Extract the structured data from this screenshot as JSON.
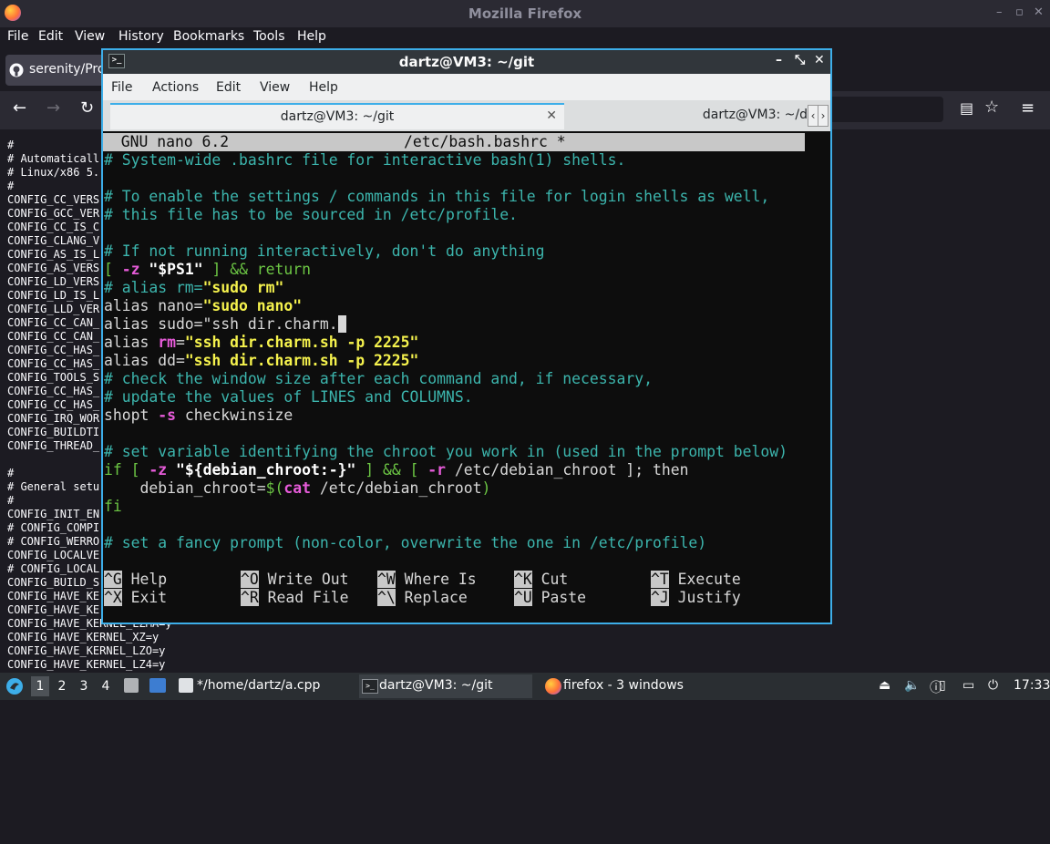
{
  "firefox": {
    "title": "Mozilla Firefox",
    "window_controls": [
      "–",
      "▫",
      "✕"
    ],
    "menu": [
      "File",
      "Edit",
      "View",
      "History",
      "Bookmarks",
      "Tools",
      "Help"
    ],
    "tab_label": "serenity/Pro",
    "content_lines": [
      "#",
      "# Automaticall",
      "# Linux/x86 5.",
      "#",
      "CONFIG_CC_VERS",
      "CONFIG_GCC_VER",
      "CONFIG_CC_IS_C",
      "CONFIG_CLANG_V",
      "CONFIG_AS_IS_L",
      "CONFIG_AS_VERS",
      "CONFIG_LD_VERS",
      "CONFIG_LD_IS_L",
      "CONFIG_LLD_VER",
      "CONFIG_CC_CAN_",
      "CONFIG_CC_CAN_",
      "CONFIG_CC_HAS_",
      "CONFIG_CC_HAS_",
      "CONFIG_TOOLS_S",
      "CONFIG_CC_HAS_",
      "CONFIG_CC_HAS_",
      "CONFIG_IRQ_WOR",
      "CONFIG_BUILDTI",
      "CONFIG_THREAD_",
      "",
      "#",
      "# General setu",
      "#",
      "CONFIG_INIT_EN",
      "# CONFIG_COMPI",
      "# CONFIG_WERRO",
      "CONFIG_LOCALVE",
      "# CONFIG_LOCAL",
      "CONFIG_BUILD_S",
      "CONFIG_HAVE_KE",
      "CONFIG_HAVE_KE",
      "CONFIG_HAVE_KERNEL_LZMA=y",
      "CONFIG_HAVE_KERNEL_XZ=y",
      "CONFIG_HAVE_KERNEL_LZO=y",
      "CONFIG_HAVE_KERNEL_LZ4=y"
    ]
  },
  "terminal": {
    "title": "dartz@VM3: ~/git",
    "menu": [
      "File",
      "Actions",
      "Edit",
      "View",
      "Help"
    ],
    "tabs": [
      {
        "label": "dartz@VM3: ~/git",
        "active": true
      },
      {
        "label": "dartz@VM3: ~/d",
        "active": false
      }
    ],
    "tab_close": "✕",
    "scroll_left": "‹",
    "scroll_right": "›"
  },
  "nano": {
    "header_left": "  GNU nano 6.2",
    "header_file": "/etc/bash.bashrc *",
    "lines": [
      {
        "t": "# System-wide .bashrc file for interactive bash(1) shells.",
        "c": "cm"
      },
      {
        "t": "",
        "c": "cm"
      },
      {
        "t": "# To enable the settings / commands in this file for login shells as well,",
        "c": "cm"
      },
      {
        "t": "# this file has to be sourced in /etc/profile.",
        "c": "cm"
      },
      {
        "t": "",
        "c": "cm"
      },
      {
        "t": "# If not running interactively, don't do anything",
        "c": "cm"
      }
    ],
    "l7": {
      "a": "[ ",
      "b": "-z",
      "c": " ",
      "d": "\"$PS1\"",
      "e": " ] && return"
    },
    "l8": {
      "a": "# alias rm=",
      "b": "\"sudo rm\""
    },
    "l9": {
      "a": "alias nano=",
      "b": "\"sudo nano\""
    },
    "l10": {
      "a": "alias sudo=\"ssh dir.charm.",
      "cursor": " "
    },
    "l11": {
      "a": "alias ",
      "b": "rm",
      "c": "=",
      "d": "\"ssh dir.charm.sh -p 2225\""
    },
    "l12": {
      "a": "alias dd=",
      "b": "\"ssh dir.charm.sh -p 2225\""
    },
    "l13": "# check the window size after each command and, if necessary,",
    "l14": "# update the values of LINES and COLUMNS.",
    "l15": {
      "a": "shopt ",
      "b": "-s",
      "c": " checkwinsize"
    },
    "l16": "",
    "l17": "# set variable identifying the chroot you work in (used in the prompt below)",
    "l18": {
      "a": "if [ ",
      "b": "-z",
      "c": " ",
      "d": "\"${debian_chroot:-}\"",
      "e": " ] && [ ",
      "f": "-r",
      "g": " /etc/debian_chroot ]; then"
    },
    "l19": {
      "a": "    debian_chroot=",
      "b": "$(",
      "c": "cat",
      "d": " /etc/debian_chroot",
      "e": ")"
    },
    "l20": "fi",
    "l21": "",
    "l22": "# set a fancy prompt (non-color, overwrite the one in /etc/profile)",
    "shortcuts": [
      [
        {
          "k": "^G",
          "l": "Help"
        },
        {
          "k": "^O",
          "l": "Write Out"
        },
        {
          "k": "^W",
          "l": "Where Is"
        },
        {
          "k": "^K",
          "l": "Cut"
        },
        {
          "k": "^T",
          "l": "Execute"
        }
      ],
      [
        {
          "k": "^X",
          "l": "Exit"
        },
        {
          "k": "^R",
          "l": "Read File"
        },
        {
          "k": "^\\",
          "l": "Replace"
        },
        {
          "k": "^U",
          "l": "Paste"
        },
        {
          "k": "^J",
          "l": "Justify"
        }
      ]
    ]
  },
  "taskbar": {
    "desktops": [
      "1",
      "2",
      "3",
      "4"
    ],
    "tasks": [
      {
        "label": "*/home/dartz/a.cpp",
        "icon": "text-editor-icon"
      },
      {
        "label": "dartz@VM3: ~/git",
        "icon": "terminal-icon"
      },
      {
        "label": "firefox - 3 windows",
        "icon": "firefox-icon"
      }
    ],
    "clock": "17:33"
  },
  "colors": {
    "accent": "#3daee9",
    "comment": "#3cb5ad",
    "string": "#f5f24d",
    "flag": "#e65bd9",
    "keyword": "#6cc644"
  }
}
